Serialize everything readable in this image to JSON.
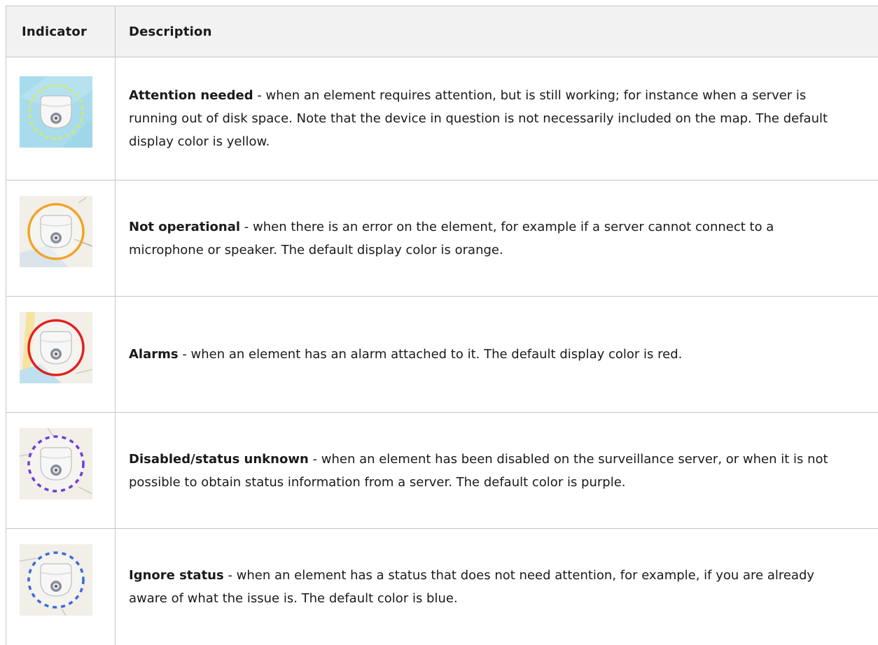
{
  "table": {
    "headers": {
      "indicator": "Indicator",
      "description": "Description"
    },
    "rows": [
      {
        "title": "Attention needed",
        "separator": " - ",
        "text": "when an element requires attention, but is still working; for instance when a server is running out of disk space. Note that the device in question is not necessarily included on the map. The default display color is yellow.",
        "icon": "camera-attention-yellow-icon",
        "ring_color": "#d4e86a"
      },
      {
        "title": "Not operational",
        "separator": " - ",
        "text": "when there is an error on the element, for example if a server cannot connect to a microphone or speaker. The default display color is orange.",
        "icon": "camera-not-operational-orange-icon",
        "ring_color": "#f0a32a"
      },
      {
        "title": "Alarms",
        "separator": " - ",
        "text": "when an element has an alarm attached to it. The default display color is red.",
        "icon": "camera-alarm-red-icon",
        "ring_color": "#e02020"
      },
      {
        "title": "Disabled/status unknown",
        "separator": " - ",
        "text": "when an element has been disabled on the surveillance server, or when it is not possible to obtain status information from a server. The default color is purple.",
        "icon": "camera-disabled-purple-icon",
        "ring_color": "#6a3fd4"
      },
      {
        "title": "Ignore status",
        "separator": " - ",
        "text": "when an element has a status that does not need attention, for example, if you are already aware of what the issue is. The default color is blue.",
        "icon": "camera-ignore-blue-icon",
        "ring_color": "#3a6ad8"
      }
    ]
  }
}
